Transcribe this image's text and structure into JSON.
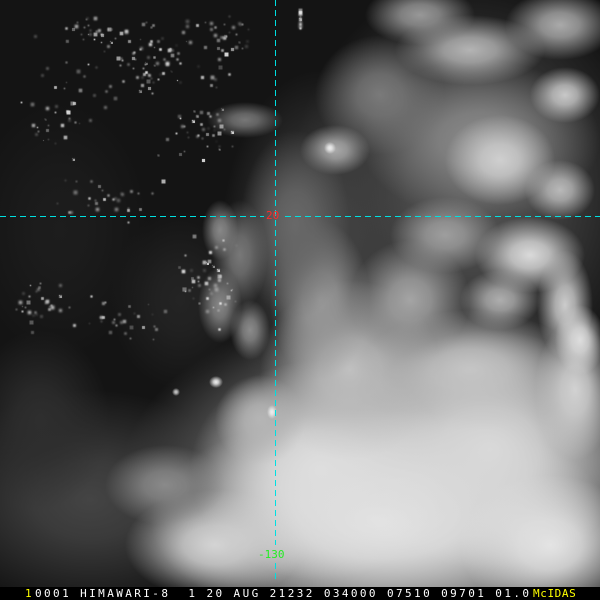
{
  "grid": {
    "latitude_label": "20",
    "longitude_label": "-130",
    "line_color": "#00e0e0",
    "latitude_label_color": "#ff2a2a",
    "longitude_label_color": "#22ee22"
  },
  "status_bar": {
    "frame": "1",
    "fields": [
      "0001",
      "HIMAWARI-8",
      "1",
      "20",
      "AUG",
      "21232",
      "034000",
      "07510",
      "09701",
      "01.0"
    ],
    "brand": "McIDAS",
    "frame_color": "#ffff00",
    "header_color": "#ffffff",
    "brand_color": "#ffff00"
  }
}
